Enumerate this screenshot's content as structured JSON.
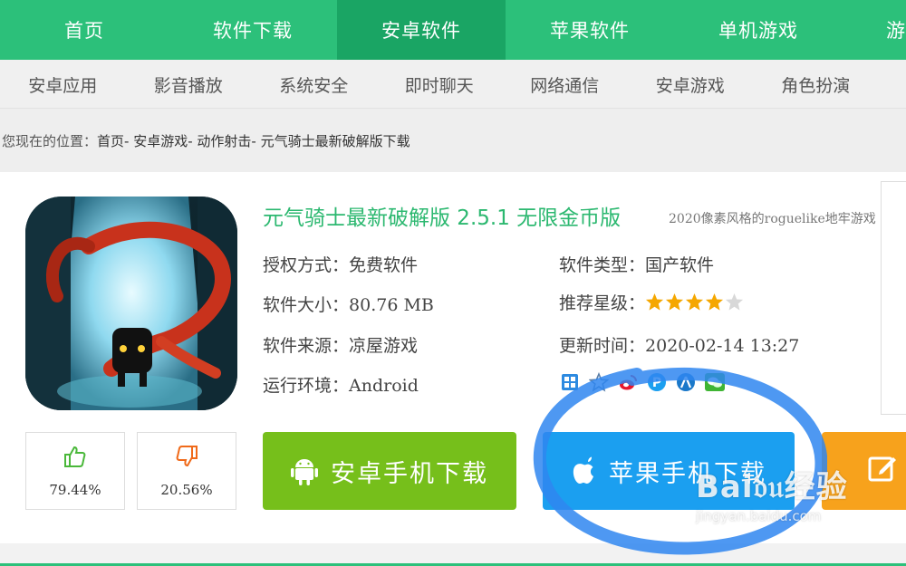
{
  "topnav": {
    "items": [
      "首页",
      "软件下载",
      "安卓软件",
      "苹果软件",
      "单机游戏",
      "游"
    ],
    "active_index": 2
  },
  "subnav": {
    "items": [
      "安卓应用",
      "影音播放",
      "系统安全",
      "即时聊天",
      "网络通信",
      "安卓游戏",
      "角色扮演"
    ]
  },
  "breadcrumb": {
    "prefix": "您现在的位置：",
    "links": [
      "首页",
      "- 安卓游戏",
      "- 动作射击",
      " - 元气骑士最新破解版下载"
    ]
  },
  "app": {
    "title": "元气骑士最新破解版 2.5.1 无限金币版",
    "subtitle": "2020像素风格的roguelike地牢游戏",
    "fields": {
      "license_label": "授权方式：",
      "license_value": "免费软件",
      "size_label": "软件大小：",
      "size_value": "80.76 MB",
      "source_label": "软件来源：",
      "source_value": "凉屋游戏",
      "env_label": "运行环境：",
      "env_value": "Android",
      "type_label": "软件类型：",
      "type_value": "国产软件",
      "rating_label": "推荐星级：",
      "rating_stars": 4,
      "rating_max": 5,
      "updated_label": "更新时间：",
      "updated_value": "2020-02-14 13:27"
    },
    "share_icons": [
      "qzone-icon",
      "favorite-icon",
      "weibo-icon",
      "pinterest-icon",
      "renren-icon",
      "wechat-icon"
    ]
  },
  "votes": {
    "up_pct": "79.44%",
    "down_pct": "20.56%"
  },
  "buttons": {
    "android_label": "安卓手机下载",
    "apple_label": "苹果手机下载"
  },
  "watermark": {
    "line1": "Bai𝔡𝔲经验",
    "line2": "jingyan.baidu.com"
  },
  "colors": {
    "brand_green": "#2cc07a",
    "android_green": "#76bf1b",
    "apple_blue": "#1b9ff0",
    "orange": "#f7a21c",
    "star_gold": "#f5a700",
    "annotation_blue": "#2f86f0"
  }
}
